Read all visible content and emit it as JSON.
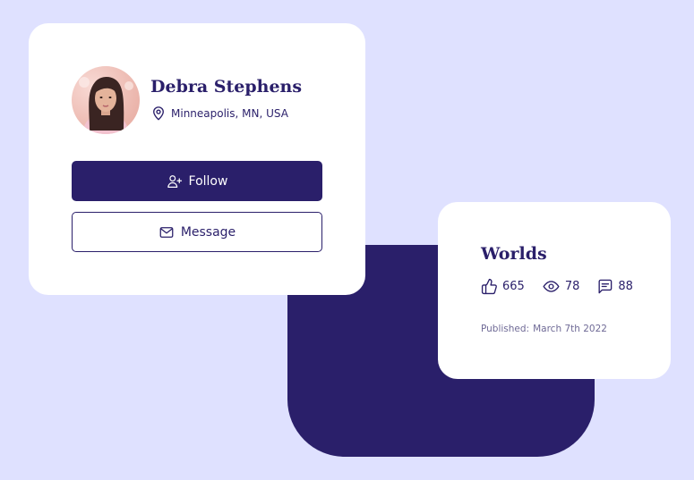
{
  "profile": {
    "name": "Debra Stephens",
    "location": "Minneapolis, MN, USA",
    "follow_label": "Follow",
    "message_label": "Message"
  },
  "post": {
    "title": "Worlds",
    "likes": "665",
    "views": "78",
    "comments": "88",
    "published_label": "Published:",
    "published_date": "March 7th 2022"
  },
  "icons": {
    "location": "map-pin-icon",
    "follow": "user-plus-icon",
    "message": "mail-icon",
    "likes": "thumbs-up-icon",
    "views": "eye-icon",
    "comments": "message-square-icon"
  },
  "colors": {
    "background": "#dfe1ff",
    "accent": "#2a1f6a",
    "card": "#ffffff",
    "muted_text": "#6f6a96"
  }
}
